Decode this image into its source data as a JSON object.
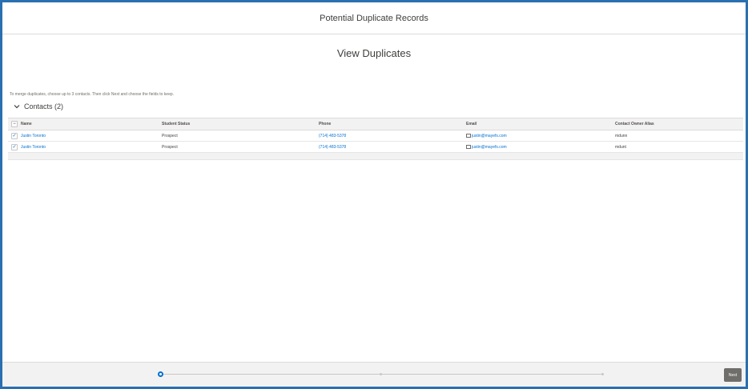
{
  "header": {
    "title": "Potential Duplicate Records"
  },
  "main": {
    "heading": "View Duplicates",
    "instructions": "To merge duplicates, choose up to 3 contacts. Then click Next and choose the fields to keep.",
    "section_label": "Contacts (2)"
  },
  "table": {
    "columns": [
      "Name",
      "Student Status",
      "Phone",
      "Email",
      "Contact Owner Alias"
    ],
    "rows": [
      {
        "name": "Justin Toronto",
        "status": "Prospect",
        "phone": "(714) 483-5378",
        "email": "justin@mayefs.com",
        "owner": "mdunn",
        "checked": "✓"
      },
      {
        "name": "Justin Toronto",
        "status": "Prospect",
        "phone": "(714) 483-5378",
        "email": "justin@mayefs.com",
        "owner": "mdunt",
        "checked": "✓"
      }
    ]
  },
  "footer": {
    "next_label": "Next"
  },
  "icons": {
    "section": "chevron-down-icon",
    "email": "email-icon",
    "select_all": "minus-checkbox-icon"
  },
  "colors": {
    "accent": "#0070d2",
    "frame": "#2a6fb0",
    "button": "#706e6b"
  }
}
